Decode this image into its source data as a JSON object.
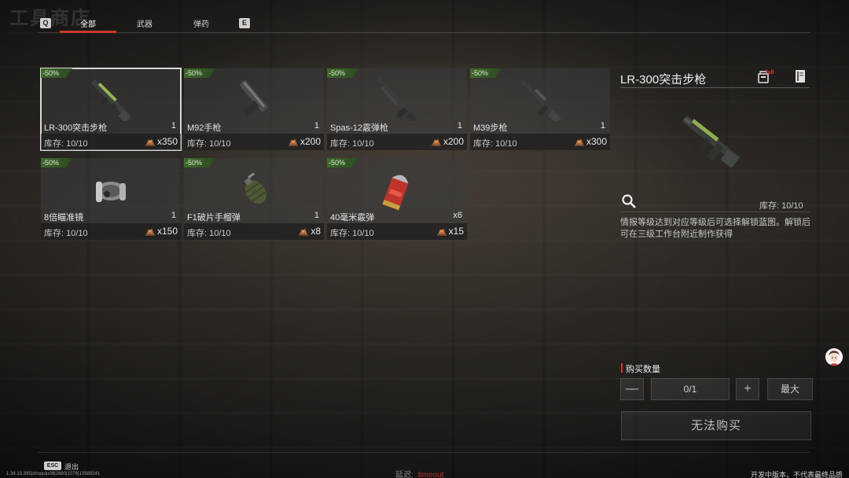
{
  "header": {
    "title": "工具商店",
    "key_left": "Q",
    "key_right": "E",
    "tabs": [
      {
        "label": "全部",
        "active": true
      },
      {
        "label": "武器",
        "active": false
      },
      {
        "label": "弹药",
        "active": false
      }
    ],
    "accent_color": "#c83a2a"
  },
  "items": [
    {
      "discount": "-50%",
      "name": "LR-300突击步枪",
      "qty": "1",
      "stock": "库存: 10/10",
      "price": "x350",
      "icon": "assault-rifle-icon",
      "selected": true
    },
    {
      "discount": "-50%",
      "name": "M92手枪",
      "qty": "1",
      "stock": "库存: 10/10",
      "price": "x200",
      "icon": "pistol-icon",
      "selected": false
    },
    {
      "discount": "-50%",
      "name": "Spas-12霰弹枪",
      "qty": "1",
      "stock": "库存: 10/10",
      "price": "x200",
      "icon": "shotgun-icon",
      "selected": false
    },
    {
      "discount": "-50%",
      "name": "M39步枪",
      "qty": "1",
      "stock": "库存: 10/10",
      "price": "x300",
      "icon": "rifle-icon",
      "selected": false
    },
    {
      "discount": "-50%",
      "name": "8倍瞄准镜",
      "qty": "1",
      "stock": "库存: 10/10",
      "price": "x150",
      "icon": "scope-icon",
      "selected": false
    },
    {
      "discount": "-50%",
      "name": "F1破片手榴弹",
      "qty": "1",
      "stock": "库存: 10/10",
      "price": "x8",
      "icon": "grenade-icon",
      "selected": false
    },
    {
      "discount": "-50%",
      "name": "40毫米霰弹",
      "qty": "x6",
      "stock": "库存: 10/10",
      "price": "x15",
      "icon": "shell-icon",
      "selected": false
    }
  ],
  "detail": {
    "title": "LR-300突击步枪",
    "badge": "full",
    "stock": "库存: 10/10",
    "description": "情报等级达到对应等级后可选择解锁蓝图。解锁后可在三级工作台附近制作获得",
    "buy_label": "购买数量",
    "minus": "—",
    "quantity": "0/1",
    "plus": "+",
    "max": "最大",
    "buy_button": "无法购买"
  },
  "footer": {
    "esc_key": "ESC",
    "esc_label": "退出",
    "debug": "1.34.15.395|shoqu|u08|2880|1076|13589241",
    "latency_label": "延迟:",
    "latency_value": "timeout",
    "version": "开发中版本，不代表最终品质"
  }
}
